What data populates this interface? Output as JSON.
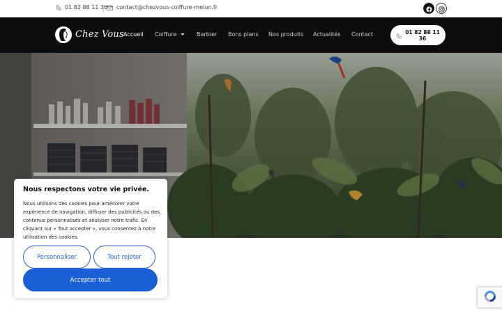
{
  "topbar": {
    "phone": "01 82 88 11 36",
    "email": "contact@chezvous-coiffure-melun.fr",
    "social": [
      {
        "icon": "facebook-icon"
      },
      {
        "icon": "instagram-icon"
      }
    ]
  },
  "header": {
    "logo_text": "Chez Vous",
    "nav": [
      {
        "label": "Accueil",
        "active": true
      },
      {
        "label": "Coiffure",
        "dropdown": true
      },
      {
        "label": "Barbier"
      },
      {
        "label": "Bons plans"
      },
      {
        "label": "Nos produits"
      },
      {
        "label": "Actualités"
      },
      {
        "label": "Contact"
      }
    ],
    "cta_phone": "01 82 88 11 36"
  },
  "cookie_banner": {
    "title": "Nous respectons votre vie privée.",
    "text": "Nous utilisons des cookies pour améliorer votre expérience de navigation, diffuser des publicités ou des contenus personnalisés et analyser notre trafic. En cliquant sur « Tout accepter », vous consentez à notre utilisation des cookies.",
    "customize_label": "Personnaliser",
    "reject_label": "Tout rejeter",
    "accept_label": "Accepter tout"
  },
  "colors": {
    "accent": "#1a5fd6",
    "nav_background": "#0d0d0d"
  }
}
